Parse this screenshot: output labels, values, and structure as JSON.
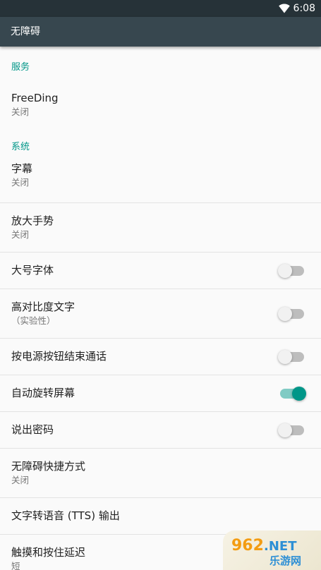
{
  "status_bar": {
    "time": "6:08",
    "wifi_icon": "wifi-icon"
  },
  "app_bar": {
    "title": "无障碍"
  },
  "sections": {
    "services": {
      "header": "服务"
    },
    "system": {
      "header": "系统"
    }
  },
  "items": {
    "freeding": {
      "title": "FreeDing",
      "summary": "关闭"
    },
    "captions": {
      "title": "字幕",
      "summary": "关闭"
    },
    "magnification": {
      "title": "放大手势",
      "summary": "关闭"
    },
    "large_text": {
      "title": "大号字体",
      "checked": false
    },
    "high_contrast": {
      "title": "高对比度文字",
      "summary": "（实验性）",
      "checked": false
    },
    "power_ends_call": {
      "title": "按电源按钮结束通话",
      "checked": false
    },
    "auto_rotate": {
      "title": "自动旋转屏幕",
      "checked": true
    },
    "speak_passwords": {
      "title": "说出密码",
      "checked": false
    },
    "shortcut": {
      "title": "无障碍快捷方式",
      "summary": "关闭"
    },
    "tts": {
      "title": "文字转语音 (TTS) 输出"
    },
    "touch_hold_delay": {
      "title": "触摸和按住延迟",
      "summary": "短"
    }
  },
  "watermark": {
    "logo": "962.NET",
    "text": "乐游网"
  },
  "colors": {
    "accent": "#009688",
    "status_bar": "#263238",
    "app_bar": "#37474f"
  }
}
